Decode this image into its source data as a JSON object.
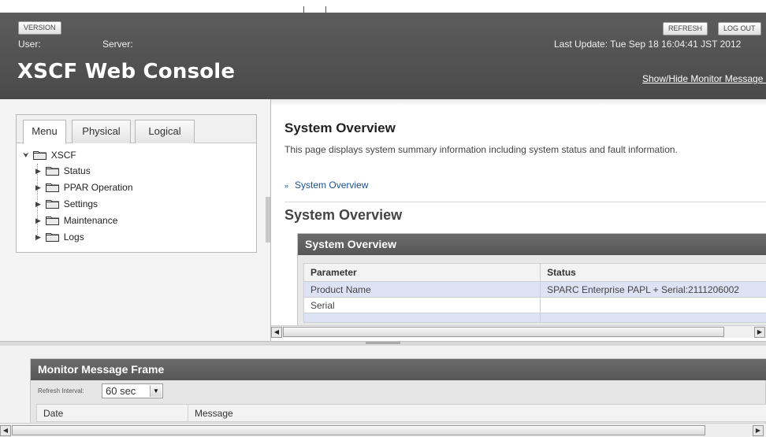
{
  "header": {
    "version_btn": "VERSION",
    "refresh_btn": "REFRESH",
    "logout_btn": "LOG OUT",
    "user_label": "User:",
    "server_label": "Server:",
    "last_update": "Last Update:  Tue Sep 18 16:04:41 JST 2012",
    "title": "XSCF Web Console",
    "show_hide": "Show/Hide Monitor Message Frame"
  },
  "nav": {
    "tabs": [
      "Menu",
      "Physical",
      "Logical"
    ],
    "active_tab": "Menu",
    "root": "XSCF",
    "items": [
      "Status",
      "PPAR Operation",
      "Settings",
      "Maintenance",
      "Logs"
    ]
  },
  "main": {
    "title": "System Overview",
    "description": "This page displays system summary information including system status and fault information.",
    "anchor_link": "System Overview",
    "section_heading": "System Overview",
    "box_title": "System Overview",
    "table": {
      "headers": [
        "Parameter",
        "Status"
      ],
      "rows": [
        [
          "Product Name",
          "SPARC Enterprise PAPL + Serial:2111206002"
        ],
        [
          "Serial",
          ""
        ]
      ]
    }
  },
  "monitor": {
    "title": "Monitor Message Frame",
    "refresh_label": "Refresh Interval:",
    "refresh_value": "60 sec",
    "headers": [
      "Date",
      "Message"
    ]
  },
  "colors": {
    "header_bg": "#4f4f4f",
    "box_header": "#5f5f5f",
    "row_highlight": "#dde3f4",
    "link": "#1a4f8f"
  },
  "icons": {
    "tree_folder": "folder-icon",
    "tree_expander": "expand-arrow-icon",
    "anchor_chevron": "double-chevron-down-icon",
    "select_arrow": "dropdown-arrow-icon"
  }
}
